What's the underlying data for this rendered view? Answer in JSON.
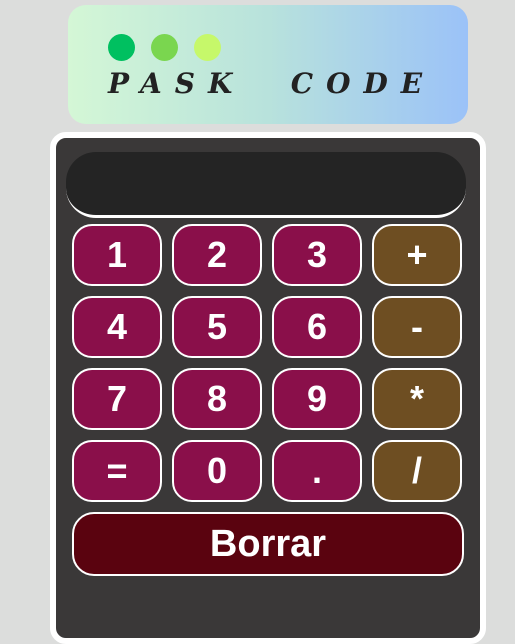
{
  "header": {
    "brand": "PASK  CODE",
    "dot_colors": [
      "#00c060",
      "#7ad64f",
      "#c6f86a"
    ]
  },
  "display": {
    "value": ""
  },
  "keypad": {
    "keys": [
      {
        "label": "1",
        "kind": "num",
        "name": "key-1"
      },
      {
        "label": "2",
        "kind": "num",
        "name": "key-2"
      },
      {
        "label": "3",
        "kind": "num",
        "name": "key-3"
      },
      {
        "label": "+",
        "kind": "op",
        "name": "key-plus"
      },
      {
        "label": "4",
        "kind": "num",
        "name": "key-4"
      },
      {
        "label": "5",
        "kind": "num",
        "name": "key-5"
      },
      {
        "label": "6",
        "kind": "num",
        "name": "key-6"
      },
      {
        "label": "-",
        "kind": "op",
        "name": "key-minus"
      },
      {
        "label": "7",
        "kind": "num",
        "name": "key-7"
      },
      {
        "label": "8",
        "kind": "num",
        "name": "key-8"
      },
      {
        "label": "9",
        "kind": "num",
        "name": "key-9"
      },
      {
        "label": "*",
        "kind": "op",
        "name": "key-multiply"
      },
      {
        "label": "=",
        "kind": "num",
        "name": "key-equals"
      },
      {
        "label": "0",
        "kind": "num",
        "name": "key-0"
      },
      {
        "label": ".",
        "kind": "num",
        "name": "key-decimal"
      },
      {
        "label": "/",
        "kind": "op",
        "name": "key-divide"
      }
    ],
    "clear_label": "Borrar"
  },
  "colors": {
    "number_key": "#8a0f4a",
    "operator_key": "#6e4e22",
    "clear_key": "#5a030f",
    "calculator_body": "#3a3838",
    "display_bg": "#242424"
  }
}
